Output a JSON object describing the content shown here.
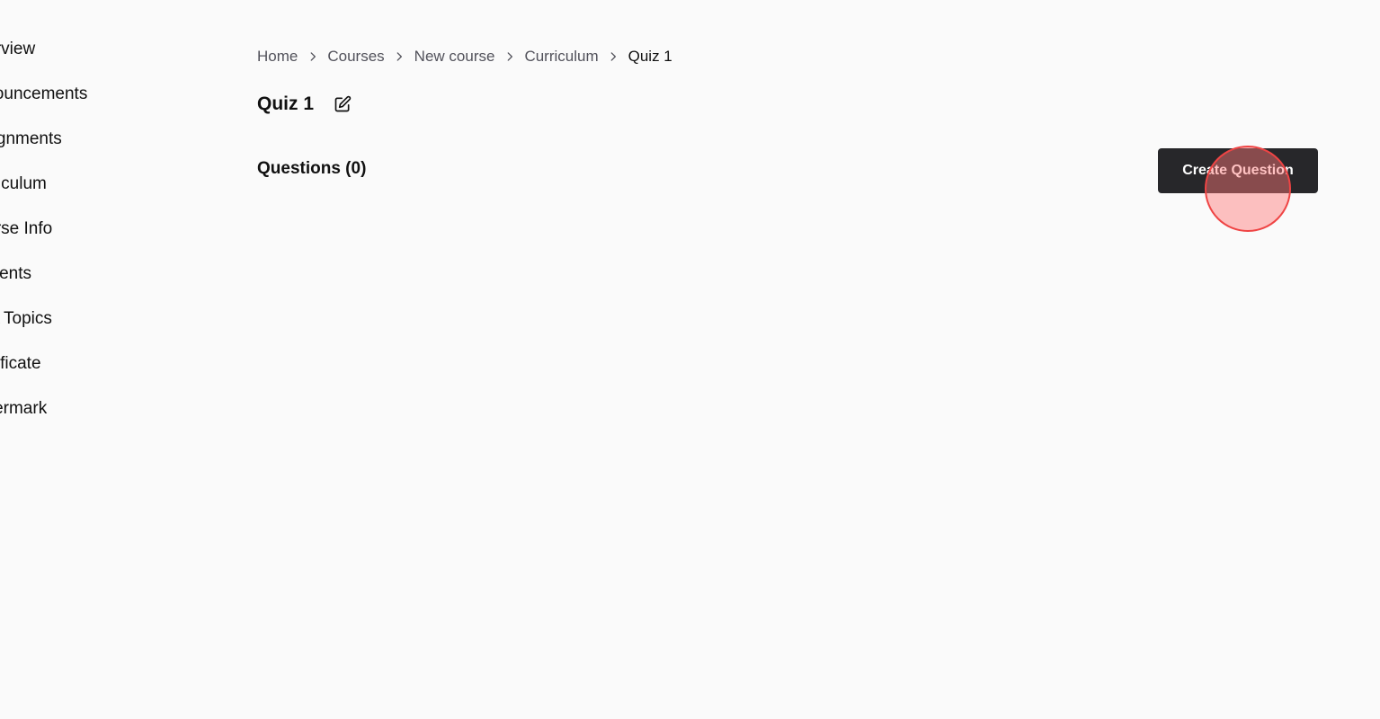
{
  "sidebar": {
    "items": [
      {
        "label": "Overview"
      },
      {
        "label": "Announcements"
      },
      {
        "label": "Assignments"
      },
      {
        "label": "Curriculum"
      },
      {
        "label": "Course Info"
      },
      {
        "label": "Students"
      },
      {
        "label": "Q&A Topics"
      },
      {
        "label": "Certificate"
      },
      {
        "label": "Watermark"
      }
    ]
  },
  "breadcrumb": {
    "items": [
      {
        "label": "Home"
      },
      {
        "label": "Courses"
      },
      {
        "label": "New course"
      },
      {
        "label": "Curriculum"
      },
      {
        "label": "Quiz 1"
      }
    ]
  },
  "page": {
    "title": "Quiz 1"
  },
  "questions": {
    "heading": "Questions (0)",
    "create_label": "Create Question"
  },
  "colors": {
    "background": "#fafafa",
    "button_bg": "#27272a",
    "button_text": "#ffffff",
    "click_indicator": "#ef4444"
  },
  "icons": {
    "edit": "pencil-square-icon",
    "separator": "chevron-right-icon"
  }
}
